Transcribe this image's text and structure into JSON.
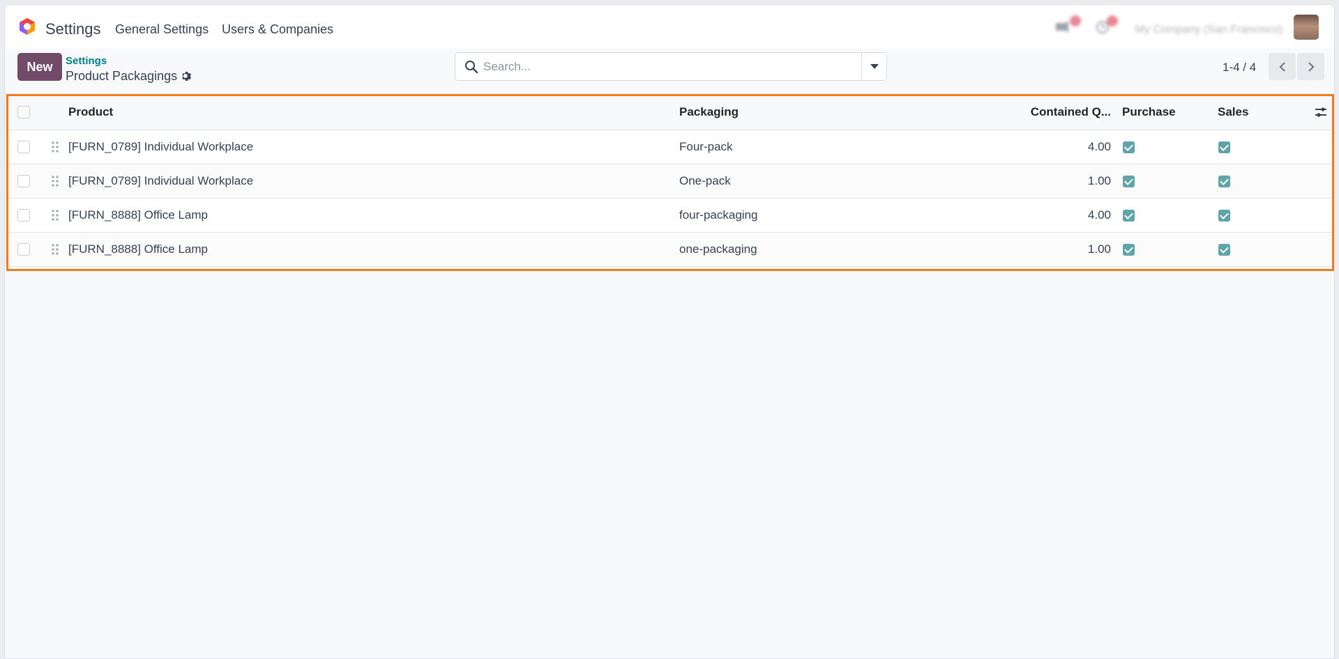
{
  "navbar": {
    "app_title": "Settings",
    "menu": [
      "General Settings",
      "Users & Companies"
    ],
    "company": "My Company (San Francisco)"
  },
  "control_panel": {
    "new_label": "New",
    "breadcrumb_parent": "Settings",
    "breadcrumb_current": "Product Packagings",
    "search_placeholder": "Search...",
    "pager_value": "1-4 / 4"
  },
  "table": {
    "columns": {
      "product": "Product",
      "packaging": "Packaging",
      "contained_qty": "Contained Q...",
      "purchase": "Purchase",
      "sales": "Sales"
    },
    "rows": [
      {
        "product": "[FURN_0789] Individual Workplace",
        "packaging": "Four-pack",
        "qty": "4.00",
        "purchase": true,
        "sales": true
      },
      {
        "product": "[FURN_0789] Individual Workplace",
        "packaging": "One-pack",
        "qty": "1.00",
        "purchase": true,
        "sales": true
      },
      {
        "product": "[FURN_8888] Office Lamp",
        "packaging": "four-packaging",
        "qty": "4.00",
        "purchase": true,
        "sales": true
      },
      {
        "product": "[FURN_8888] Office Lamp",
        "packaging": "one-packaging",
        "qty": "1.00",
        "purchase": true,
        "sales": true
      }
    ]
  },
  "colors": {
    "primary": "#714b67",
    "link": "#017e84",
    "highlight": "#f07a1c",
    "checkbox_checked": "#5fa4a9"
  }
}
